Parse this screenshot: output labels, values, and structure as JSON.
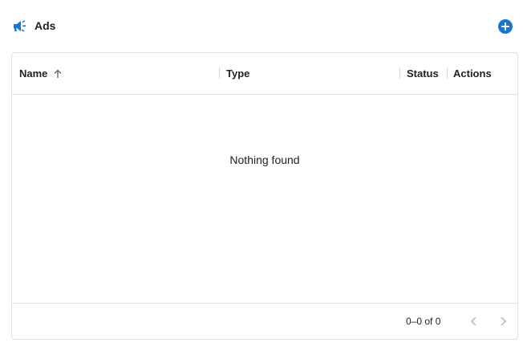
{
  "header": {
    "title": "Ads",
    "icon": "megaphone-icon",
    "add_icon": "add-circle-icon",
    "accent": "#1976d2"
  },
  "table": {
    "columns": [
      {
        "label": "Name",
        "sorted": "ascending"
      },
      {
        "label": "Type"
      },
      {
        "label": "Status"
      },
      {
        "label": "Actions"
      }
    ],
    "empty_message": "Nothing found"
  },
  "pagination": {
    "range": "0–0 of 0",
    "prev_icon": "chevron-left-icon",
    "next_icon": "chevron-right-icon"
  }
}
